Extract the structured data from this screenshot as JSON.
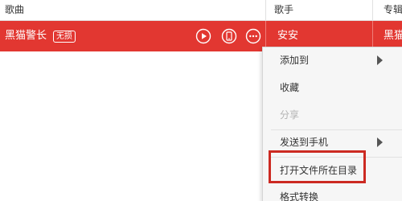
{
  "columns": {
    "song": "歌曲",
    "artist": "歌手",
    "album": "专辑"
  },
  "selected_song": {
    "title": "黑猫警长",
    "badge": "无损",
    "artist": "安安",
    "album": "黑猫警长"
  },
  "row_actions": [
    {
      "name": "play-icon"
    },
    {
      "name": "mobile-phone-icon"
    },
    {
      "name": "more-options-icon"
    }
  ],
  "context_menu": {
    "items": [
      {
        "label": "添加到",
        "has_submenu": true,
        "disabled": false
      },
      {
        "label": "收藏",
        "has_submenu": false,
        "disabled": false
      },
      {
        "label": "分享",
        "has_submenu": false,
        "disabled": true
      },
      {
        "label": "发送到手机",
        "has_submenu": true,
        "disabled": false
      },
      {
        "label": "打开文件所在目录",
        "has_submenu": false,
        "disabled": false,
        "highlighted": true
      },
      {
        "label": "格式转换",
        "has_submenu": false,
        "disabled": false
      }
    ]
  },
  "colors": {
    "selected_row": "#e23731",
    "highlight_box": "#cc2a22",
    "menu_background": "#f6f6f6"
  }
}
